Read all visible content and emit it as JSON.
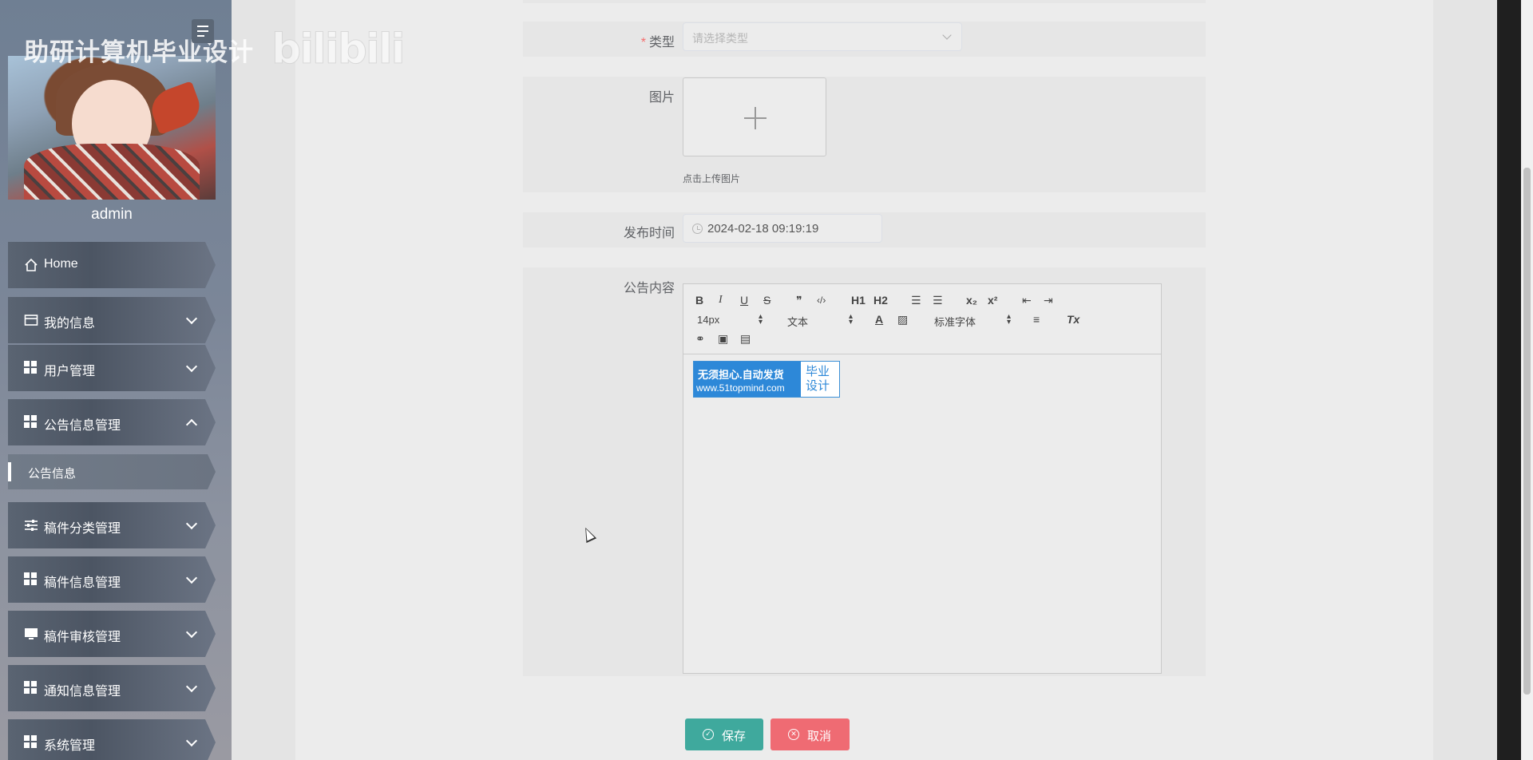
{
  "header": {
    "site_title": "助研计算机毕业设计",
    "watermark": "bilibili"
  },
  "sidebar": {
    "username": "admin",
    "menu": [
      {
        "label": "Home",
        "icon": "home-icon"
      },
      {
        "label": "我的信息",
        "icon": "card-icon"
      },
      {
        "label": "用户管理",
        "icon": "grid-icon"
      },
      {
        "label": "公告信息管理",
        "icon": "grid-icon",
        "expanded": true
      },
      {
        "label": "稿件分类管理",
        "icon": "sliders-icon"
      },
      {
        "label": "稿件信息管理",
        "icon": "grid-icon"
      },
      {
        "label": "稿件审核管理",
        "icon": "monitor-icon"
      },
      {
        "label": "通知信息管理",
        "icon": "grid-icon"
      },
      {
        "label": "系统管理",
        "icon": "grid-icon"
      }
    ],
    "submenu": [
      {
        "label": "公告信息"
      }
    ]
  },
  "form": {
    "type_label": "类型",
    "type_placeholder": "请选择类型",
    "image_label": "图片",
    "image_hint": "点击上传图片",
    "time_label": "发布时间",
    "time_value": "2024-02-18 09:19:19",
    "content_label": "公告内容"
  },
  "editor": {
    "font_size": "14px",
    "header_select": "文本",
    "font_family": "标准字体",
    "toolbar_glyphs": {
      "bold": "B",
      "italic": "I",
      "underline": "U",
      "strike": "S",
      "quote": "❞",
      "code": "‹/›",
      "h1": "H1",
      "h2": "H2",
      "ol": "☰",
      "ul": "☰",
      "sub": "x₂",
      "sup": "x²",
      "outdent": "⇤",
      "indent": "⇥",
      "color": "A",
      "background": "▨",
      "align": "≡",
      "clean": "Tx",
      "link": "⚭",
      "image": "▣",
      "video": "▤"
    },
    "banner": {
      "line1": "无须担心.自动发货",
      "line2": "www.51topmind.com",
      "side": "毕业设计"
    }
  },
  "actions": {
    "save_label": "保存",
    "cancel_label": "取消"
  },
  "colors": {
    "save": "#3fa99d",
    "cancel": "#ef6b73",
    "required": "#f56c6c"
  }
}
